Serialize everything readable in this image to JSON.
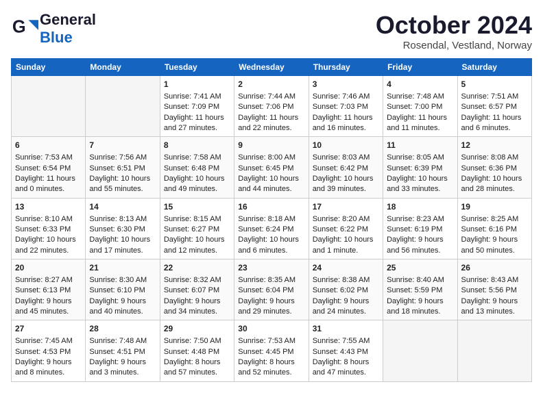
{
  "header": {
    "logo_general": "General",
    "logo_blue": "Blue",
    "month": "October 2024",
    "location": "Rosendal, Vestland, Norway"
  },
  "weekdays": [
    "Sunday",
    "Monday",
    "Tuesday",
    "Wednesday",
    "Thursday",
    "Friday",
    "Saturday"
  ],
  "weeks": [
    [
      {
        "day": "",
        "empty": true
      },
      {
        "day": "",
        "empty": true
      },
      {
        "day": "1",
        "sunrise": "Sunrise: 7:41 AM",
        "sunset": "Sunset: 7:09 PM",
        "daylight": "Daylight: 11 hours and 27 minutes."
      },
      {
        "day": "2",
        "sunrise": "Sunrise: 7:44 AM",
        "sunset": "Sunset: 7:06 PM",
        "daylight": "Daylight: 11 hours and 22 minutes."
      },
      {
        "day": "3",
        "sunrise": "Sunrise: 7:46 AM",
        "sunset": "Sunset: 7:03 PM",
        "daylight": "Daylight: 11 hours and 16 minutes."
      },
      {
        "day": "4",
        "sunrise": "Sunrise: 7:48 AM",
        "sunset": "Sunset: 7:00 PM",
        "daylight": "Daylight: 11 hours and 11 minutes."
      },
      {
        "day": "5",
        "sunrise": "Sunrise: 7:51 AM",
        "sunset": "Sunset: 6:57 PM",
        "daylight": "Daylight: 11 hours and 6 minutes."
      }
    ],
    [
      {
        "day": "6",
        "sunrise": "Sunrise: 7:53 AM",
        "sunset": "Sunset: 6:54 PM",
        "daylight": "Daylight: 11 hours and 0 minutes."
      },
      {
        "day": "7",
        "sunrise": "Sunrise: 7:56 AM",
        "sunset": "Sunset: 6:51 PM",
        "daylight": "Daylight: 10 hours and 55 minutes."
      },
      {
        "day": "8",
        "sunrise": "Sunrise: 7:58 AM",
        "sunset": "Sunset: 6:48 PM",
        "daylight": "Daylight: 10 hours and 49 minutes."
      },
      {
        "day": "9",
        "sunrise": "Sunrise: 8:00 AM",
        "sunset": "Sunset: 6:45 PM",
        "daylight": "Daylight: 10 hours and 44 minutes."
      },
      {
        "day": "10",
        "sunrise": "Sunrise: 8:03 AM",
        "sunset": "Sunset: 6:42 PM",
        "daylight": "Daylight: 10 hours and 39 minutes."
      },
      {
        "day": "11",
        "sunrise": "Sunrise: 8:05 AM",
        "sunset": "Sunset: 6:39 PM",
        "daylight": "Daylight: 10 hours and 33 minutes."
      },
      {
        "day": "12",
        "sunrise": "Sunrise: 8:08 AM",
        "sunset": "Sunset: 6:36 PM",
        "daylight": "Daylight: 10 hours and 28 minutes."
      }
    ],
    [
      {
        "day": "13",
        "sunrise": "Sunrise: 8:10 AM",
        "sunset": "Sunset: 6:33 PM",
        "daylight": "Daylight: 10 hours and 22 minutes."
      },
      {
        "day": "14",
        "sunrise": "Sunrise: 8:13 AM",
        "sunset": "Sunset: 6:30 PM",
        "daylight": "Daylight: 10 hours and 17 minutes."
      },
      {
        "day": "15",
        "sunrise": "Sunrise: 8:15 AM",
        "sunset": "Sunset: 6:27 PM",
        "daylight": "Daylight: 10 hours and 12 minutes."
      },
      {
        "day": "16",
        "sunrise": "Sunrise: 8:18 AM",
        "sunset": "Sunset: 6:24 PM",
        "daylight": "Daylight: 10 hours and 6 minutes."
      },
      {
        "day": "17",
        "sunrise": "Sunrise: 8:20 AM",
        "sunset": "Sunset: 6:22 PM",
        "daylight": "Daylight: 10 hours and 1 minute."
      },
      {
        "day": "18",
        "sunrise": "Sunrise: 8:23 AM",
        "sunset": "Sunset: 6:19 PM",
        "daylight": "Daylight: 9 hours and 56 minutes."
      },
      {
        "day": "19",
        "sunrise": "Sunrise: 8:25 AM",
        "sunset": "Sunset: 6:16 PM",
        "daylight": "Daylight: 9 hours and 50 minutes."
      }
    ],
    [
      {
        "day": "20",
        "sunrise": "Sunrise: 8:27 AM",
        "sunset": "Sunset: 6:13 PM",
        "daylight": "Daylight: 9 hours and 45 minutes."
      },
      {
        "day": "21",
        "sunrise": "Sunrise: 8:30 AM",
        "sunset": "Sunset: 6:10 PM",
        "daylight": "Daylight: 9 hours and 40 minutes."
      },
      {
        "day": "22",
        "sunrise": "Sunrise: 8:32 AM",
        "sunset": "Sunset: 6:07 PM",
        "daylight": "Daylight: 9 hours and 34 minutes."
      },
      {
        "day": "23",
        "sunrise": "Sunrise: 8:35 AM",
        "sunset": "Sunset: 6:04 PM",
        "daylight": "Daylight: 9 hours and 29 minutes."
      },
      {
        "day": "24",
        "sunrise": "Sunrise: 8:38 AM",
        "sunset": "Sunset: 6:02 PM",
        "daylight": "Daylight: 9 hours and 24 minutes."
      },
      {
        "day": "25",
        "sunrise": "Sunrise: 8:40 AM",
        "sunset": "Sunset: 5:59 PM",
        "daylight": "Daylight: 9 hours and 18 minutes."
      },
      {
        "day": "26",
        "sunrise": "Sunrise: 8:43 AM",
        "sunset": "Sunset: 5:56 PM",
        "daylight": "Daylight: 9 hours and 13 minutes."
      }
    ],
    [
      {
        "day": "27",
        "sunrise": "Sunrise: 7:45 AM",
        "sunset": "Sunset: 4:53 PM",
        "daylight": "Daylight: 9 hours and 8 minutes."
      },
      {
        "day": "28",
        "sunrise": "Sunrise: 7:48 AM",
        "sunset": "Sunset: 4:51 PM",
        "daylight": "Daylight: 9 hours and 3 minutes."
      },
      {
        "day": "29",
        "sunrise": "Sunrise: 7:50 AM",
        "sunset": "Sunset: 4:48 PM",
        "daylight": "Daylight: 8 hours and 57 minutes."
      },
      {
        "day": "30",
        "sunrise": "Sunrise: 7:53 AM",
        "sunset": "Sunset: 4:45 PM",
        "daylight": "Daylight: 8 hours and 52 minutes."
      },
      {
        "day": "31",
        "sunrise": "Sunrise: 7:55 AM",
        "sunset": "Sunset: 4:43 PM",
        "daylight": "Daylight: 8 hours and 47 minutes."
      },
      {
        "day": "",
        "empty": true
      },
      {
        "day": "",
        "empty": true
      }
    ]
  ]
}
